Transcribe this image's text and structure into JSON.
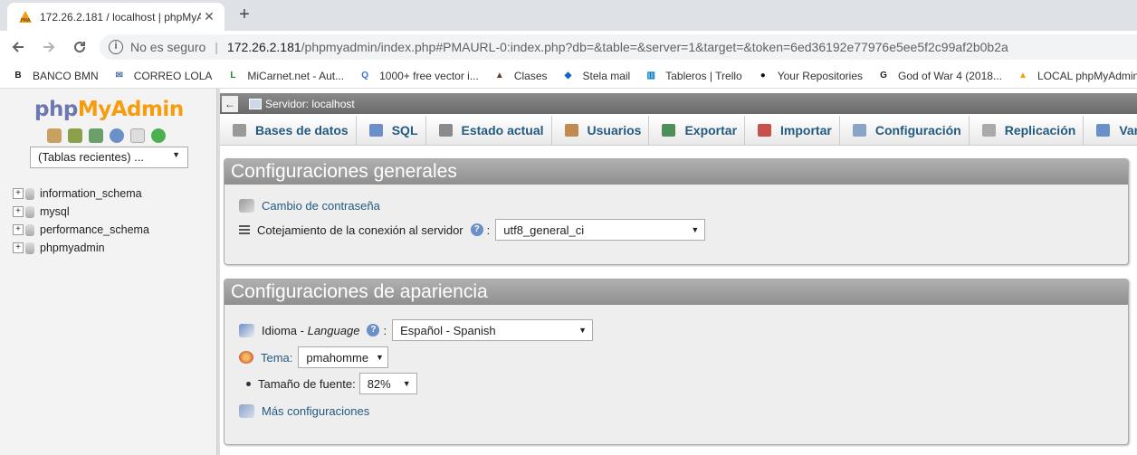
{
  "browser": {
    "tab_title": "172.26.2.181 / localhost | phpMyA",
    "tab_close": "✕",
    "new_tab": "+",
    "security_label": "No es seguro",
    "url_host": "172.26.2.181",
    "url_rest": "/phpmyadmin/index.php#PMAURL-0:index.php?db=&table=&server=1&target=&token=6ed36192e77976e5ee5f2c99af2b0b2a",
    "bookmarks": [
      {
        "label": "BANCO BMN",
        "icon": "banco-bmn-icon",
        "color": "#1a1a1a",
        "glyph": "B"
      },
      {
        "label": "CORREO LOLA",
        "icon": "mail-icon",
        "color": "#4a6fa5",
        "glyph": "✉"
      },
      {
        "label": "MiCarnet.net - Aut...",
        "icon": "micarnet-icon",
        "color": "#2e7d32",
        "glyph": "L"
      },
      {
        "label": "1000+ free vector i...",
        "icon": "vector-icon",
        "color": "#3b6fd6",
        "glyph": "Q"
      },
      {
        "label": "Clases",
        "icon": "clases-icon",
        "color": "#5d4037",
        "glyph": "▲"
      },
      {
        "label": "Stela mail",
        "icon": "stela-icon",
        "color": "#1565c0",
        "glyph": "◆"
      },
      {
        "label": "Tableros | Trello",
        "icon": "trello-icon",
        "color": "#0079bf",
        "glyph": "▥"
      },
      {
        "label": "Your Repositories",
        "icon": "github-icon",
        "color": "#111111",
        "glyph": "●"
      },
      {
        "label": "God of War 4 (2018...",
        "icon": "gow-icon",
        "color": "#222222",
        "glyph": "G"
      },
      {
        "label": "LOCAL phpMyAdmin",
        "icon": "pma-icon",
        "color": "#f89c0e",
        "glyph": "▲"
      }
    ]
  },
  "pma": {
    "logo": {
      "php": "php",
      "my": "My",
      "admin": "Admin"
    },
    "recent_tables": "(Tablas recientes) ...",
    "databases": [
      "information_schema",
      "mysql",
      "performance_schema",
      "phpmyadmin"
    ],
    "server_label": "Servidor: localhost",
    "collapse": "←",
    "menu": [
      {
        "label": "Bases de datos",
        "icon": "databases-icon"
      },
      {
        "label": "SQL",
        "icon": "sql-icon"
      },
      {
        "label": "Estado actual",
        "icon": "status-icon"
      },
      {
        "label": "Usuarios",
        "icon": "users-icon"
      },
      {
        "label": "Exportar",
        "icon": "export-icon"
      },
      {
        "label": "Importar",
        "icon": "import-icon"
      },
      {
        "label": "Configuración",
        "icon": "settings-icon"
      },
      {
        "label": "Replicación",
        "icon": "replication-icon"
      },
      {
        "label": "Variables",
        "icon": "variables-icon"
      }
    ],
    "general": {
      "title": "Configuraciones generales",
      "change_password": "Cambio de contraseña",
      "collation_label": "Cotejamiento de la conexión al servidor",
      "collation_value": "utf8_general_ci"
    },
    "appearance": {
      "title": "Configuraciones de apariencia",
      "language_label": "Idioma",
      "language_sep": " - ",
      "language_en": "Language",
      "language_value": "Español - Spanish",
      "theme_label": "Tema:",
      "theme_value": "pmahomme",
      "font_label": "Tamaño de fuente:",
      "font_value": "82%",
      "more_settings": "Más configuraciones"
    },
    "help_glyph": "?",
    "colon": ":",
    "caret": "▼"
  }
}
